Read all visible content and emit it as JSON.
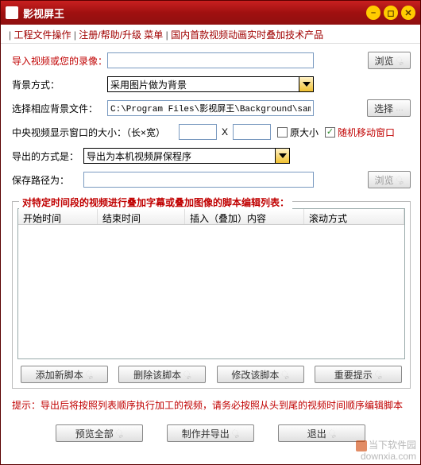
{
  "window": {
    "title": "影视屏王"
  },
  "menu": {
    "item1": "工程文件操作",
    "item2": "注册/帮助/升级 菜单",
    "item3": "国内首款视频动画实时叠加技术产品"
  },
  "form": {
    "import_label": "导入视频或您的录像：",
    "import_value": "",
    "bg_mode_label": "背景方式：",
    "bg_mode_value": "采用图片做为背景",
    "bg_file_label": "选择相应背景文件：",
    "bg_file_value": "C:\\Program Files\\影视屏王\\Background\\sample",
    "size_label": "中央视频显示窗口的大小：（长×宽）",
    "size_w": "",
    "size_x": "X",
    "size_h": "",
    "orig_size_label": "原大小",
    "random_move_label": "随机移动窗口",
    "export_mode_label": "导出的方式是：",
    "export_mode_value": "导出为本机视频屏保程序",
    "save_path_label": "保存路径为：",
    "save_path_value": ""
  },
  "buttons": {
    "browse": "浏览",
    "select": "选择",
    "browse_disabled": "浏览"
  },
  "group": {
    "legend": "对特定时间段的视频进行叠加字幕或叠加图像的脚本编辑列表：",
    "cols": {
      "c1": "开始时间",
      "c2": "结束时间",
      "c3": "插入（叠加）内容",
      "c4": "滚动方式"
    },
    "btns": {
      "add": "添加新脚本",
      "del": "删除该脚本",
      "edit": "修改该脚本",
      "tip": "重要提示"
    }
  },
  "hint": "提示：导出后将按照列表顺序执行加工的视频，请务必按照从头到尾的视频时间顺序编辑脚本",
  "bottom": {
    "preview": "预览全部",
    "make": "制作并导出",
    "exit": "退出"
  },
  "watermark": {
    "line1": "当下软件园",
    "line2": "downxia.com"
  }
}
